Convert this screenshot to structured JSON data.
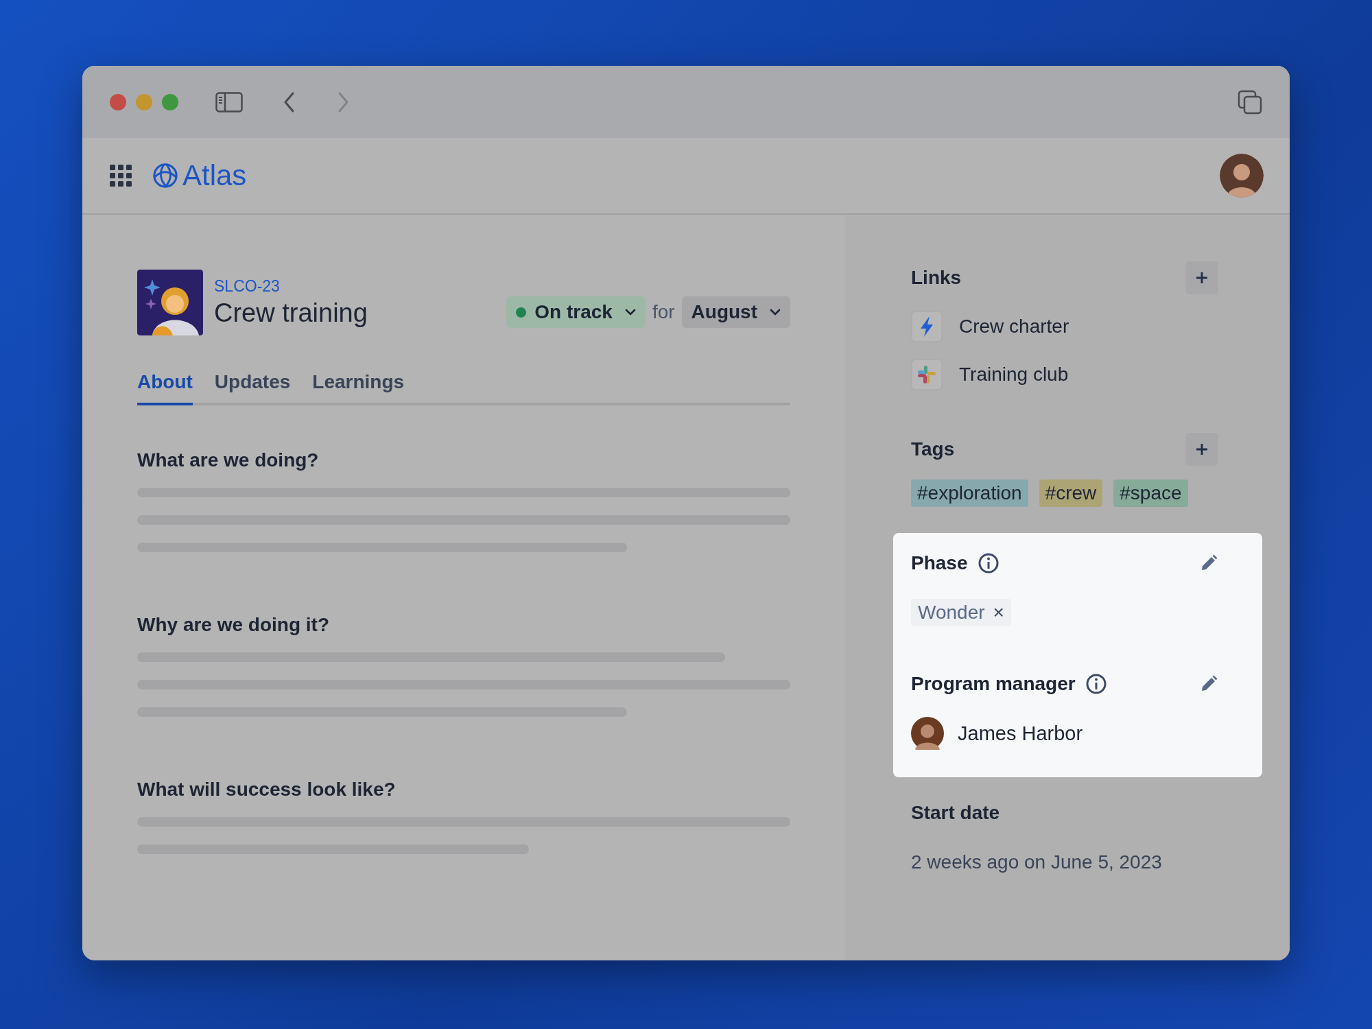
{
  "app": {
    "name": "Atlas"
  },
  "project": {
    "key": "SLCO-23",
    "title": "Crew training",
    "status": "On track",
    "for_label": "for",
    "period": "August"
  },
  "tabs": [
    {
      "label": "About",
      "selected": true
    },
    {
      "label": "Updates",
      "selected": false
    },
    {
      "label": "Learnings",
      "selected": false
    }
  ],
  "sections": [
    {
      "heading": "What are we doing?"
    },
    {
      "heading": "Why are we doing it?"
    },
    {
      "heading": "What will success look like?"
    }
  ],
  "links": {
    "heading": "Links",
    "items": [
      {
        "label": "Crew charter",
        "kind": "bolt"
      },
      {
        "label": "Training club",
        "kind": "hash"
      }
    ]
  },
  "tags": {
    "heading": "Tags",
    "items": [
      {
        "label": "#exploration",
        "color": "#87a9ae"
      },
      {
        "label": "#crew",
        "color": "#ada476"
      },
      {
        "label": "#space",
        "color": "#86ab98"
      }
    ]
  },
  "highlighted_fields": {
    "highlighted": true,
    "phase": {
      "label": "Phase",
      "value": "Wonder",
      "remove": "×"
    },
    "program_manager": {
      "label": "Program manager",
      "name": "James Harbor"
    }
  },
  "start_date": {
    "label": "Start date",
    "value": "2 weeks ago on June 5, 2023"
  }
}
